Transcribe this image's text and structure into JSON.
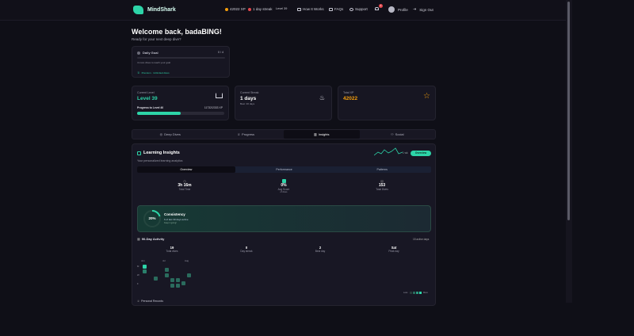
{
  "nav": {
    "brand": "MindShark",
    "xp": "42022 XP",
    "streak": "1 day streak",
    "level": "Level 39",
    "how_it_works": "How It Works",
    "faqs": "FAQs",
    "support": "Support",
    "notifications": "1",
    "profile": "Profile",
    "sign_out": "Sign Out"
  },
  "welcome": {
    "title": "Welcome back, badaBING!",
    "subtitle": "Ready for your next deep dive?"
  },
  "daily_goal": {
    "title": "Daily Goal",
    "count": "0 / 4",
    "text": "4 more dives to reach your goal",
    "badge": "Premium · Unlimited dives"
  },
  "level_card": {
    "label": "Current Level",
    "value": "Level 39",
    "progress_label": "Progress to Level 40",
    "progress_value": "11732/2333 XP",
    "progress_fraction": 0.5
  },
  "streak_card": {
    "label": "Current Streak",
    "value": "1 days",
    "sub": "Best: 36 days"
  },
  "xp_card": {
    "label": "Total XP",
    "value": "42022"
  },
  "tabs": [
    "Deep Dives",
    "Progress",
    "Insights",
    "Social"
  ],
  "insights": {
    "title": "Learning Insights",
    "subtitle": "Your personalized learning analytics",
    "trend_label": "1 wk",
    "overview_badge": "Overview",
    "subtabs": [
      "Overview",
      "Performance",
      "Patterns"
    ],
    "stats": [
      {
        "value": "3h 16m",
        "label": "Total Time"
      },
      {
        "value": "0%",
        "label": "Avg Score",
        "sub": "of dives"
      },
      {
        "value": "153",
        "label": "Total Dives"
      }
    ],
    "consistency": {
      "percent": "20%",
      "title": "Consistency",
      "text": "6 of last 30 days active",
      "sub": "Keep it going!"
    },
    "activity": {
      "title": "90-Day Activity",
      "right": "15 active days",
      "stats": [
        {
          "value": "19",
          "label": "Total dives"
        },
        {
          "value": "0",
          "label": "Day streak"
        },
        {
          "value": "2",
          "label": "Best day"
        },
        {
          "value": "Sat",
          "label": "Peak day"
        }
      ],
      "months": [
        "Jun",
        "Jul",
        "Aug"
      ],
      "days": [
        "M",
        "W",
        "F"
      ],
      "legend_less": "Less",
      "legend_more": "More"
    },
    "next_section": "Personal Records"
  },
  "colors": {
    "accent": "#2dd4a8",
    "xp": "#f59e0b",
    "background": "#0f0f17"
  }
}
